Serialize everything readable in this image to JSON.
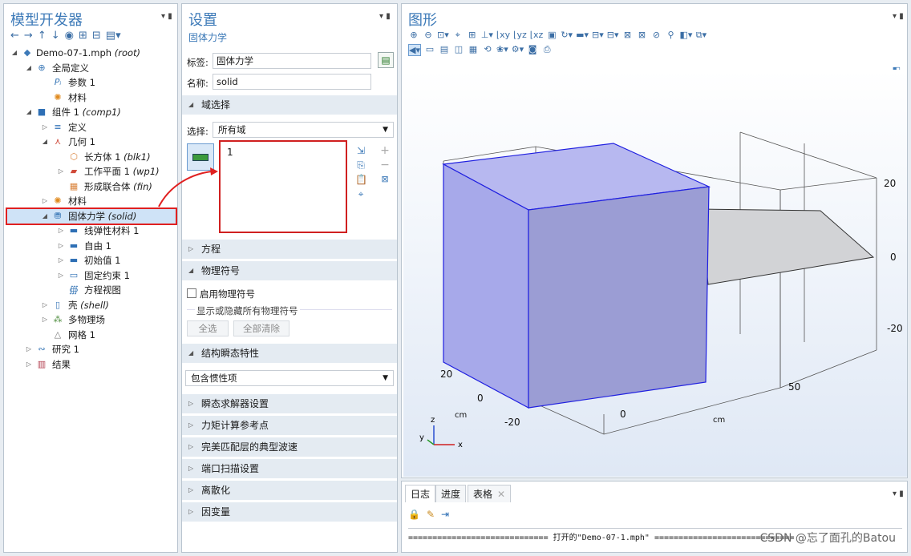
{
  "model_builder": {
    "title": "模型开发器",
    "toolbar_icons": [
      "arrow-left-icon",
      "arrow-right-icon",
      "arrow-up-icon",
      "arrow-down-icon",
      "eye-icon",
      "expand-icon",
      "collapse-icon",
      "list-icon"
    ],
    "toolbar_glyphs": [
      "←",
      "→",
      "↑",
      "↓",
      "◉",
      "⊞",
      "⊟",
      "▤▾"
    ],
    "tree": {
      "root": {
        "name": "Demo-07-1.mph",
        "tag": "(root)"
      },
      "global_defs": "全局定义",
      "params": "参数 1",
      "materials_global": "材料",
      "component": {
        "name": "组件 1",
        "tag": "(comp1)"
      },
      "definitions": "定义",
      "geometry": "几何 1",
      "block": {
        "name": "长方体 1",
        "tag": "(blk1)"
      },
      "workplane": {
        "name": "工作平面 1",
        "tag": "(wp1)"
      },
      "union": {
        "name": "形成联合体",
        "tag": "(fin)"
      },
      "materials": "材料",
      "solid": {
        "name": "固体力学",
        "tag": "(solid)"
      },
      "linear_elastic": "线弹性材料 1",
      "free": "自由 1",
      "initial_values": "初始值 1",
      "fixed": "固定约束 1",
      "equation_view": "方程视图",
      "shell": {
        "name": "壳",
        "tag": "(shell)"
      },
      "multiphysics": "多物理场",
      "mesh": "网格 1",
      "study": "研究 1",
      "results": "结果"
    }
  },
  "settings": {
    "title": "设置",
    "subtitle": "固体力学",
    "label_caption": "标签:",
    "label_value": "固体力学",
    "name_caption": "名称:",
    "name_value": "solid",
    "domain_section": "域选择",
    "selection_caption": "选择:",
    "selection_value": "所有域",
    "domain_list": [
      "1"
    ],
    "equation_section": "方程",
    "symbols_section": "物理符号",
    "enable_symbols": "启用物理符号",
    "show_hide_symbols": "显示或隐藏所有物理符号",
    "select_all": "全选",
    "clear_all": "全部清除",
    "transient_section": "结构瞬态特性",
    "transient_value": "包含惯性项",
    "sections_collapsed": [
      "瞬态求解器设置",
      "力矩计算参考点",
      "完美匹配层的典型波速",
      "端口扫描设置",
      "离散化",
      "因变量"
    ]
  },
  "graphics": {
    "title": "图形",
    "axis_units": "cm",
    "tick_labels": {
      "right": [
        "20",
        "0",
        "-20"
      ],
      "bottom_right": [
        "50"
      ],
      "left_depth": [
        "20",
        "0",
        "-20"
      ],
      "bottom_center": [
        "0"
      ]
    },
    "axes": {
      "x": "x",
      "y": "y",
      "z": "z"
    },
    "cube_color": "#a9abe8"
  },
  "log": {
    "tabs": [
      "日志",
      "进度",
      "表格"
    ],
    "line": "============================= 打开的\"Demo-07-1.mph\" ============================="
  },
  "watermark": "CSDN @忘了面孔的Batou"
}
